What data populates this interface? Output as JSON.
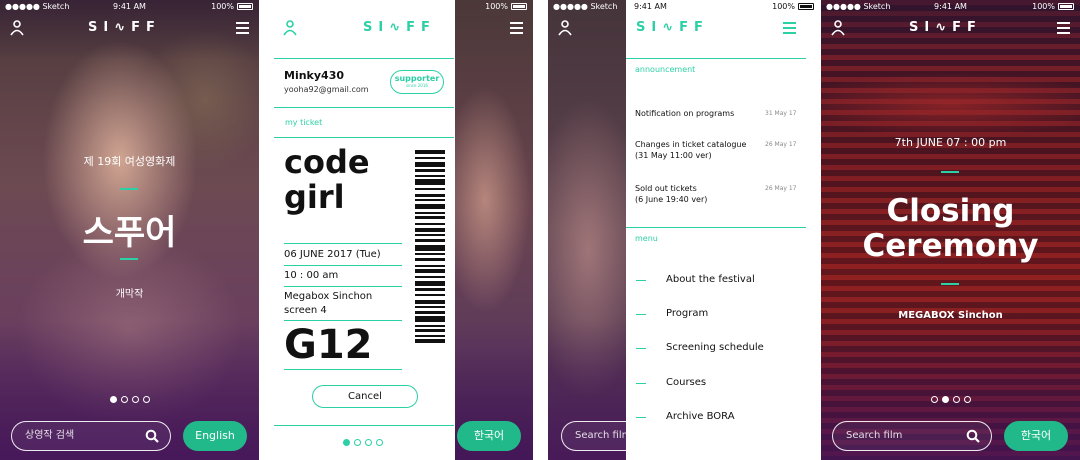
{
  "colors": {
    "accent": "#2cd0a5",
    "accent_button": "#22b98a"
  },
  "status_bar": {
    "carrier": "●●●●● Sketch",
    "time": "9:41 AM",
    "battery": "100%"
  },
  "logo": "SI∿FF",
  "screen1": {
    "edition": "제 19회 여성영화제",
    "title": "스푸어",
    "subtitle": "개막작",
    "search_placeholder": "상영작 검색",
    "language_button": "English"
  },
  "ticket": {
    "username": "Minky430",
    "email": "yooha92@gmail.com",
    "badge_title": "supporter",
    "badge_sub": "since 2016",
    "section_label": "my ticket",
    "movie_line1": "code",
    "movie_line2": "girl",
    "date": "06 JUNE 2017 (Tue)",
    "time": "10 : 00 am",
    "venue_line1": "Megabox Sinchon",
    "venue_line2": "screen 4",
    "seat": "G12",
    "cancel_button": "Cancel"
  },
  "screen3": {
    "language_button": "한국어"
  },
  "drawer": {
    "search_placeholder": "Search film",
    "announcement_label": "announcement",
    "announcements": [
      {
        "line1": "Notification on programs",
        "line2": "",
        "date": "31 May 17"
      },
      {
        "line1": "Changes in ticket catalogue",
        "line2": "(31 May 11:00 ver)",
        "date": "26 May 17"
      },
      {
        "line1": "Sold out tickets",
        "line2": "(6 June 19:40 ver)",
        "date": "26 May 17"
      }
    ],
    "menu_label": "menu",
    "menu_items": [
      "About the festival",
      "Program",
      "Screening schedule",
      "Courses",
      "Archive BORA"
    ]
  },
  "closing": {
    "datetime": "7th JUNE 07 : 00 pm",
    "title_line1": "Closing",
    "title_line2": "Ceremony",
    "venue": "MEGABOX Sinchon",
    "search_placeholder": "Search film",
    "language_button": "한국어"
  }
}
